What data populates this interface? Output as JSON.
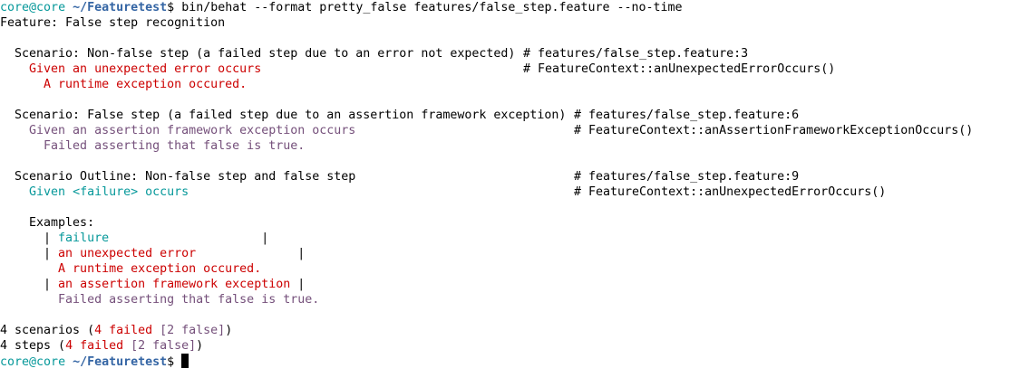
{
  "prompt": {
    "user": "core",
    "at": "@",
    "host": "core",
    "space": " ",
    "path": "~/Featuretest",
    "dollar": "$ ",
    "command": "bin/behat --format pretty_false features/false_step.feature --no-time"
  },
  "feature": {
    "title": "Feature: False step recognition"
  },
  "scenarios": [
    {
      "title": "  Scenario: Non-false step (a failed step due to an error not expected)",
      "location": "# features/false_step.feature:3",
      "step": "    Given an unexpected error occurs",
      "definition": "# FeatureContext::anUnexpectedErrorOccurs()",
      "message": "      A runtime exception occured."
    },
    {
      "title": "  Scenario: False step (a failed step due to an assertion framework exception)",
      "location": "# features/false_step.feature:6",
      "step": "    Given an assertion framework exception occurs",
      "definition": "# FeatureContext::anAssertionFrameworkExceptionOccurs()",
      "message": "      Failed asserting that false is true."
    },
    {
      "title": "  Scenario Outline: Non-false step and false step",
      "location": "# features/false_step.feature:9",
      "step_prefix": "    Given ",
      "step_param": "<failure>",
      "step_suffix": " occurs",
      "definition": "# FeatureContext::anUnexpectedErrorOccurs()"
    }
  ],
  "examples": {
    "label": "    Examples:",
    "pipe_indent": "      | ",
    "pipe_end": " |",
    "header": "failure",
    "header_pad": "                    ",
    "rows": [
      {
        "value": "an unexpected error",
        "pad": "             ",
        "message": "        A runtime exception occured."
      },
      {
        "value": "an assertion framework exception",
        "pad": "",
        "message": "        Failed asserting that false is true."
      }
    ]
  },
  "summary": {
    "scenarios_prefix": "4 scenarios (",
    "scenarios_failed": "4 failed",
    "scenarios_false": " [2 false]",
    "scenarios_suffix": ")",
    "steps_prefix": "4 steps (",
    "steps_failed": "4 failed",
    "steps_false": " [2 false]",
    "steps_suffix": ")"
  },
  "colors": {
    "prompt": "#06989a",
    "path": "#3465a4",
    "failed": "#cc0000",
    "false": "#75507b",
    "param": "#06989a"
  }
}
